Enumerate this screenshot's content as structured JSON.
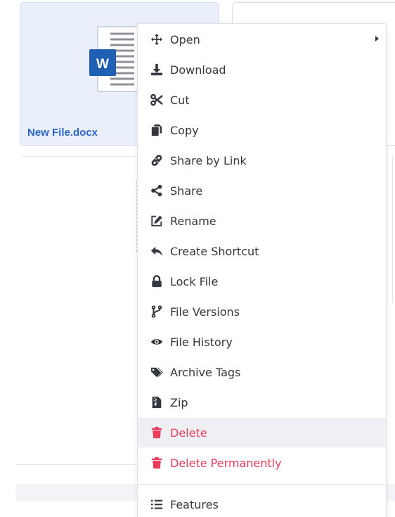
{
  "file": {
    "name": "New File.docx",
    "icon": "word-document-icon"
  },
  "context_menu": {
    "items": [
      {
        "label": "Open",
        "icon": "move-arrows-icon",
        "has_submenu": true
      },
      {
        "label": "Download",
        "icon": "download-icon"
      },
      {
        "label": "Cut",
        "icon": "scissors-icon"
      },
      {
        "label": "Copy",
        "icon": "copy-icon"
      },
      {
        "label": "Share by Link",
        "icon": "link-icon"
      },
      {
        "label": "Share",
        "icon": "share-icon"
      },
      {
        "label": "Rename",
        "icon": "edit-icon"
      },
      {
        "label": "Create Shortcut",
        "icon": "reply-arrow-icon"
      },
      {
        "label": "Lock File",
        "icon": "lock-icon"
      },
      {
        "label": "File Versions",
        "icon": "branch-icon"
      },
      {
        "label": "File History",
        "icon": "eye-icon"
      },
      {
        "label": "Archive Tags",
        "icon": "tags-icon"
      },
      {
        "label": "Zip",
        "icon": "zip-file-icon"
      },
      {
        "label": "Delete",
        "icon": "trash-icon",
        "danger": true,
        "hovered": true
      },
      {
        "label": "Delete Permanently",
        "icon": "trash-icon",
        "danger": true
      },
      {
        "label": "Features",
        "icon": "list-icon"
      }
    ]
  },
  "colors": {
    "accent": "#2a64c8",
    "danger": "#ea3d5c",
    "card_selected": "#e9f0fc",
    "word_blue": "#1f5fb4"
  }
}
